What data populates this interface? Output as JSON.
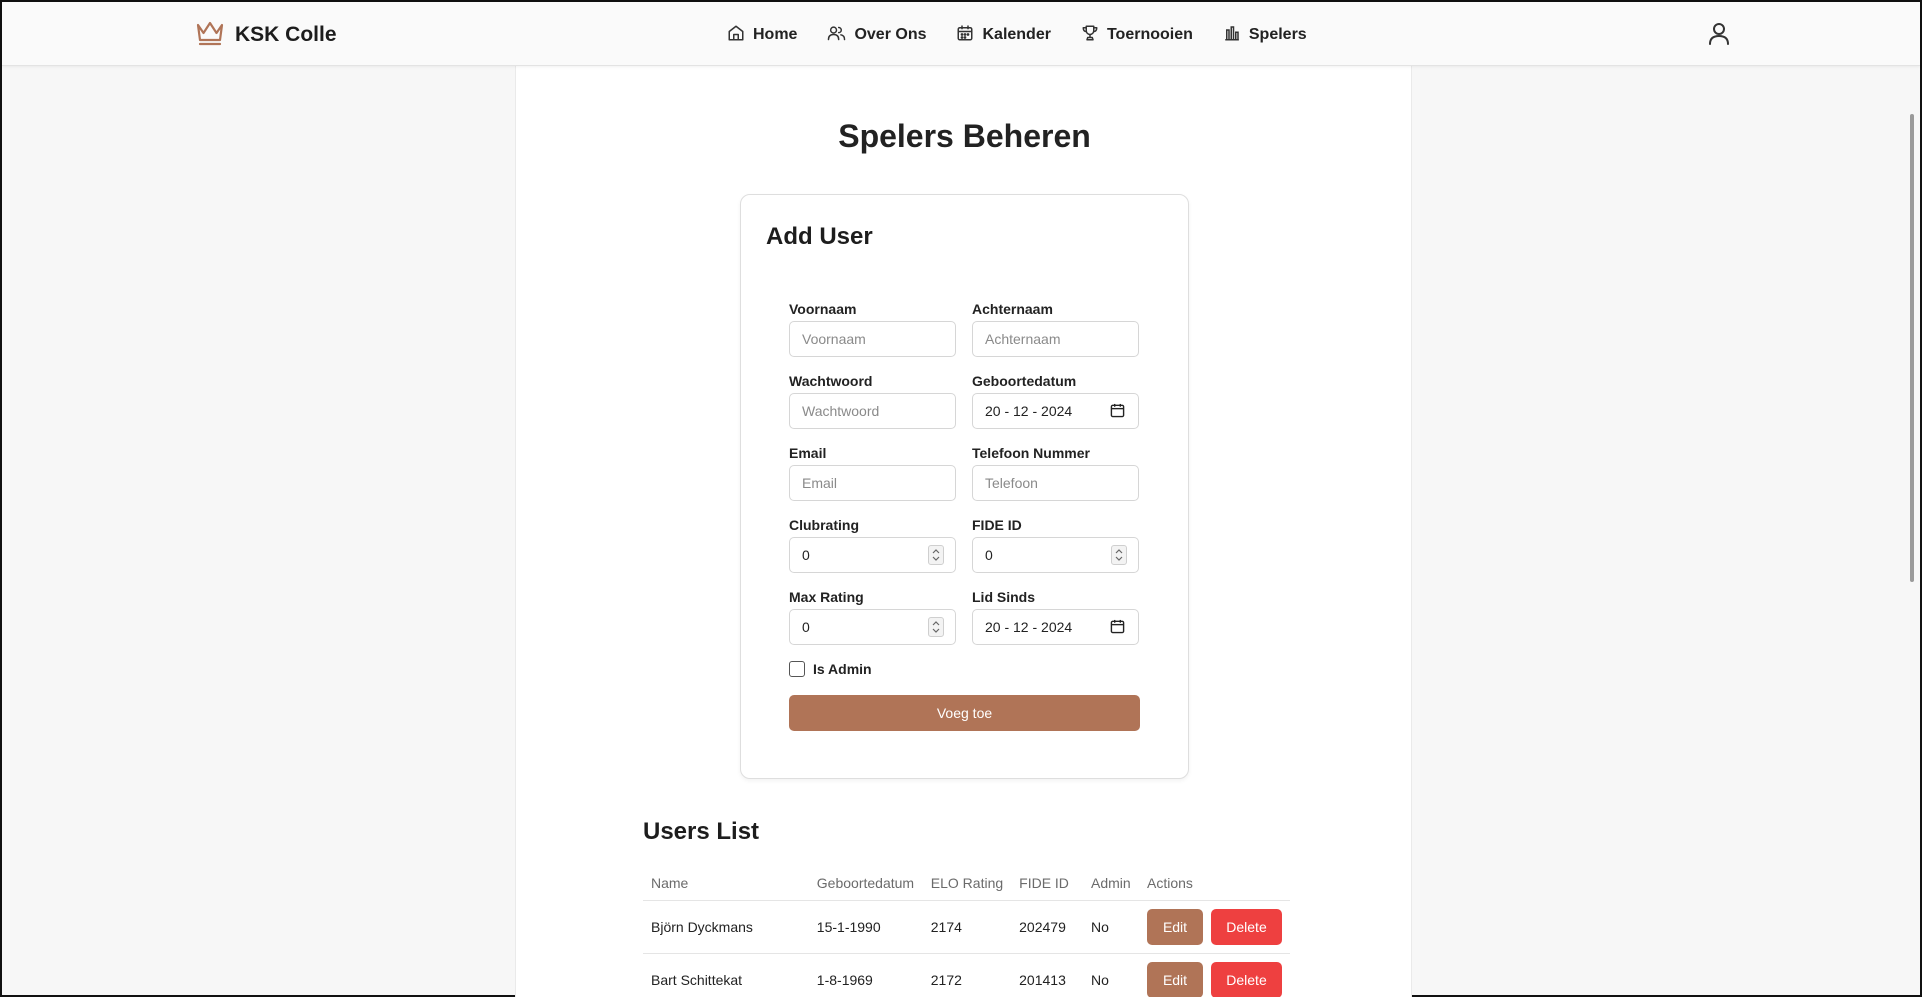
{
  "header": {
    "brand": "KSK Colle",
    "nav": [
      {
        "label": "Home",
        "icon": "home-icon"
      },
      {
        "label": "Over Ons",
        "icon": "users-icon"
      },
      {
        "label": "Kalender",
        "icon": "calendar-icon"
      },
      {
        "label": "Toernooien",
        "icon": "trophy-icon"
      },
      {
        "label": "Spelers",
        "icon": "bar-chart-icon"
      }
    ]
  },
  "page": {
    "title": "Spelers Beheren"
  },
  "form": {
    "title": "Add User",
    "voornaam": {
      "label": "Voornaam",
      "placeholder": "Voornaam"
    },
    "achternaam": {
      "label": "Achternaam",
      "placeholder": "Achternaam"
    },
    "wachtwoord": {
      "label": "Wachtwoord",
      "placeholder": "Wachtwoord"
    },
    "geboortedatum": {
      "label": "Geboortedatum",
      "value": "20 - 12 - 2024"
    },
    "email": {
      "label": "Email",
      "placeholder": "Email"
    },
    "telefoon": {
      "label": "Telefoon Nummer",
      "placeholder": "Telefoon"
    },
    "clubrating": {
      "label": "Clubrating",
      "value": "0"
    },
    "fide_id": {
      "label": "FIDE ID",
      "value": "0"
    },
    "max_rating": {
      "label": "Max Rating",
      "value": "0"
    },
    "lid_sinds": {
      "label": "Lid Sinds",
      "value": "20 - 12 - 2024"
    },
    "is_admin": {
      "label": "Is Admin",
      "checked": false
    },
    "submit_label": "Voeg toe"
  },
  "users": {
    "title": "Users List",
    "columns": [
      "Name",
      "Geboortedatum",
      "ELO Rating",
      "FIDE ID",
      "Admin",
      "Actions"
    ],
    "rows": [
      {
        "name": "Björn Dyckmans",
        "geboortedatum": "15-1-1990",
        "elo": "2174",
        "fide": "202479",
        "admin": "No"
      },
      {
        "name": "Bart Schittekat",
        "geboortedatum": "1-8-1969",
        "elo": "2172",
        "fide": "201413",
        "admin": "No"
      }
    ],
    "edit_label": "Edit",
    "delete_label": "Delete"
  },
  "colors": {
    "accent": "#b07457",
    "danger": "#ee4040",
    "background": "#f7f7f7"
  }
}
